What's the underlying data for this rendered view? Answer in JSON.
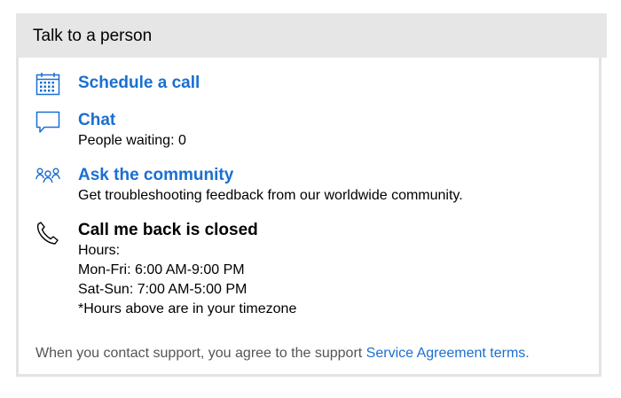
{
  "panel": {
    "title": "Talk to a person"
  },
  "schedule": {
    "icon": "calendar-icon",
    "label": "Schedule a call"
  },
  "chat": {
    "icon": "chat-bubble-icon",
    "label": "Chat",
    "status": "People waiting: 0"
  },
  "community": {
    "icon": "people-group-icon",
    "label": "Ask the community",
    "description": "Get troubleshooting feedback from our worldwide community."
  },
  "callback": {
    "icon": "phone-icon",
    "label": "Call me back is closed",
    "hours_label": "Hours:",
    "hours_weekday": "Mon-Fri: 6:00 AM-9:00 PM",
    "hours_weekend": "Sat-Sun: 7:00 AM-5:00 PM",
    "timezone_note": "*Hours above are in your timezone"
  },
  "footer": {
    "text": "When you contact support, you agree to the support ",
    "link_label": "Service Agreement terms."
  },
  "colors": {
    "link": "#1a6fd1",
    "header_bg": "#e6e6e6",
    "border": "#e3e3e3"
  }
}
